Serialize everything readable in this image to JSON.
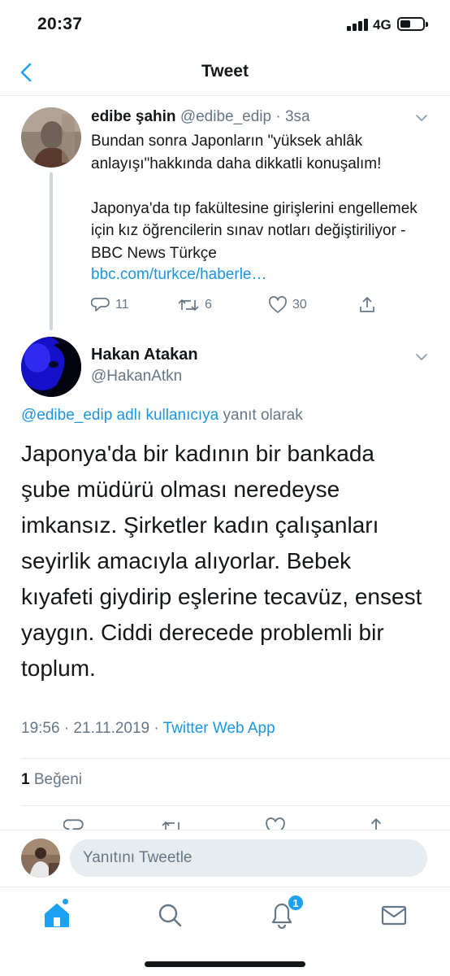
{
  "status_bar": {
    "time": "20:37",
    "network": "4G"
  },
  "nav": {
    "title": "Tweet"
  },
  "parent_tweet": {
    "name": "edibe şahin",
    "handle": "@edibe_edip",
    "time": "3sa",
    "text": "Bundan sonra Japonların \"yüksek  ahlâk anlayışı\"hakkında daha dikkatli konuşalım!\n\nJaponya'da tıp fakültesine girişlerini engellemek için kız öğrencilerin sınav notları değiştiriliyor - BBC News Türkçe",
    "link": "bbc.com/turkce/haberle…",
    "replies": "11",
    "retweets": "6",
    "likes": "30"
  },
  "main_tweet": {
    "name": "Hakan Atakan",
    "handle": "@HakanAtkn",
    "reply_to_link": "@edibe_edip adlı kullanıcıya",
    "reply_to_suffix": " yanıt olarak",
    "text": "Japonya'da bir kadının bir bankada şube müdürü olması neredeyse imkansız. Şirketler kadın çalışanları seyirlik amacıyla alıyorlar. Bebek kıyafeti giydirip eşlerine tecavüz, ensest yaygın. Ciddi derecede problemli bir toplum.",
    "timestamp": "19:56 · 21.11.2019 · ",
    "source": "Twitter Web App",
    "likes_count": "1",
    "likes_label": " Beğeni"
  },
  "composer": {
    "placeholder": "Yanıtını Tweetle"
  },
  "tabbar": {
    "notifications_badge": "1"
  },
  "colors": {
    "accent": "#1da1f2",
    "link": "#1b95e0",
    "muted": "#657786",
    "text": "#14171a"
  }
}
